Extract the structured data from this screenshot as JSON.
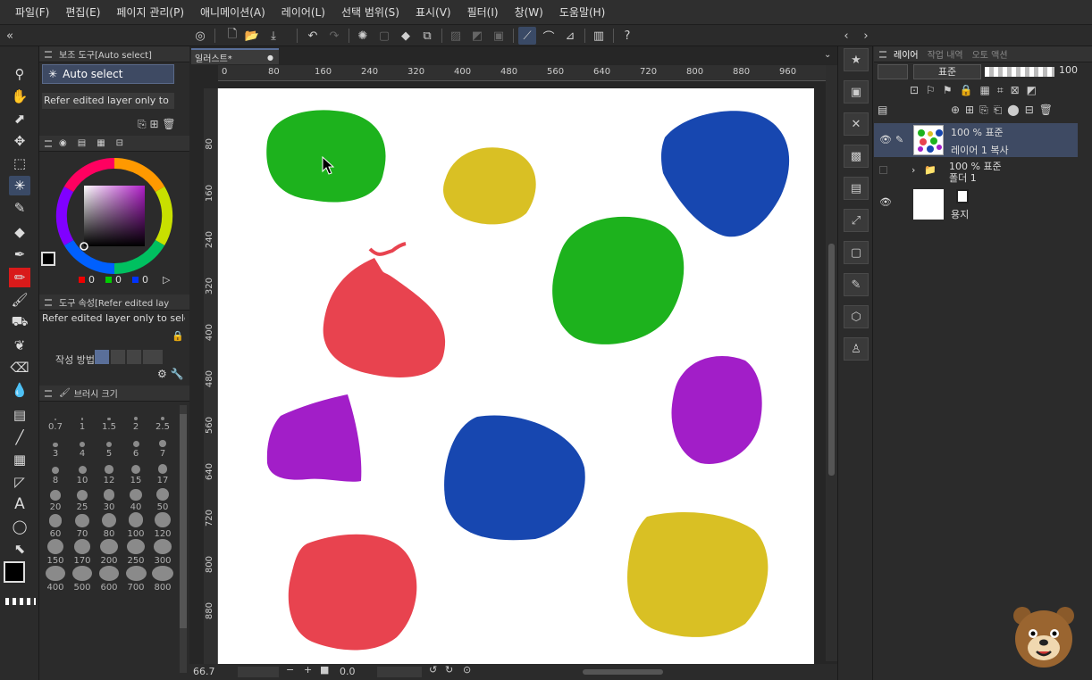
{
  "menu": [
    "파일(F)",
    "편집(E)",
    "페이지 관리(P)",
    "애니메이션(A)",
    "레이어(L)",
    "선택 범위(S)",
    "표시(V)",
    "필터(I)",
    "창(W)",
    "도움말(H)"
  ],
  "subtool": {
    "header": "보조 도구[Auto select]",
    "item_label": "Auto select",
    "option_text": "Refer edited layer only to"
  },
  "color": {
    "r": "0",
    "g": "0",
    "b": "0",
    "main_color": "#000000",
    "sub_color": "#4a3a6e"
  },
  "tool_property": {
    "header": "도구 속성[Refer edited lay",
    "option_text": "Refer edited layer only to select",
    "mode_label": "작성 방법"
  },
  "brush_size": {
    "header": "브러시 크기",
    "sizes": [
      "0.7",
      "1",
      "1.5",
      "2",
      "2.5",
      "3",
      "4",
      "5",
      "6",
      "7",
      "8",
      "10",
      "12",
      "15",
      "17",
      "20",
      "25",
      "30",
      "40",
      "50",
      "60",
      "70",
      "80",
      "100",
      "120",
      "150",
      "170",
      "200",
      "250",
      "300",
      "400",
      "500",
      "600",
      "700",
      "800"
    ]
  },
  "canvas": {
    "tab_title": "일러스트*",
    "ruler_h": [
      "0",
      "80",
      "160",
      "240",
      "320",
      "400",
      "480",
      "560",
      "640",
      "720",
      "800",
      "880",
      "960"
    ],
    "ruler_v": [
      "80",
      "160",
      "240",
      "320",
      "400",
      "480",
      "560",
      "640",
      "720",
      "800",
      "880"
    ],
    "zoom": "66.7",
    "angle": "0.0"
  },
  "layers_panel": {
    "tabs": [
      "레이어",
      "작업 내역",
      "오토 액션"
    ],
    "blend_mode": "표준",
    "opacity": "100",
    "layers": [
      {
        "mode": "100 % 표준",
        "name": "레이어 1 복사"
      },
      {
        "mode": "100 % 표준",
        "name": "폴더 1"
      },
      {
        "mode": "",
        "name": "용지"
      }
    ]
  },
  "blob_colors": {
    "green": "#1db21d",
    "yellow": "#d9c024",
    "blue": "#1747b0",
    "red": "#e8434f",
    "purple": "#a21ec8"
  }
}
